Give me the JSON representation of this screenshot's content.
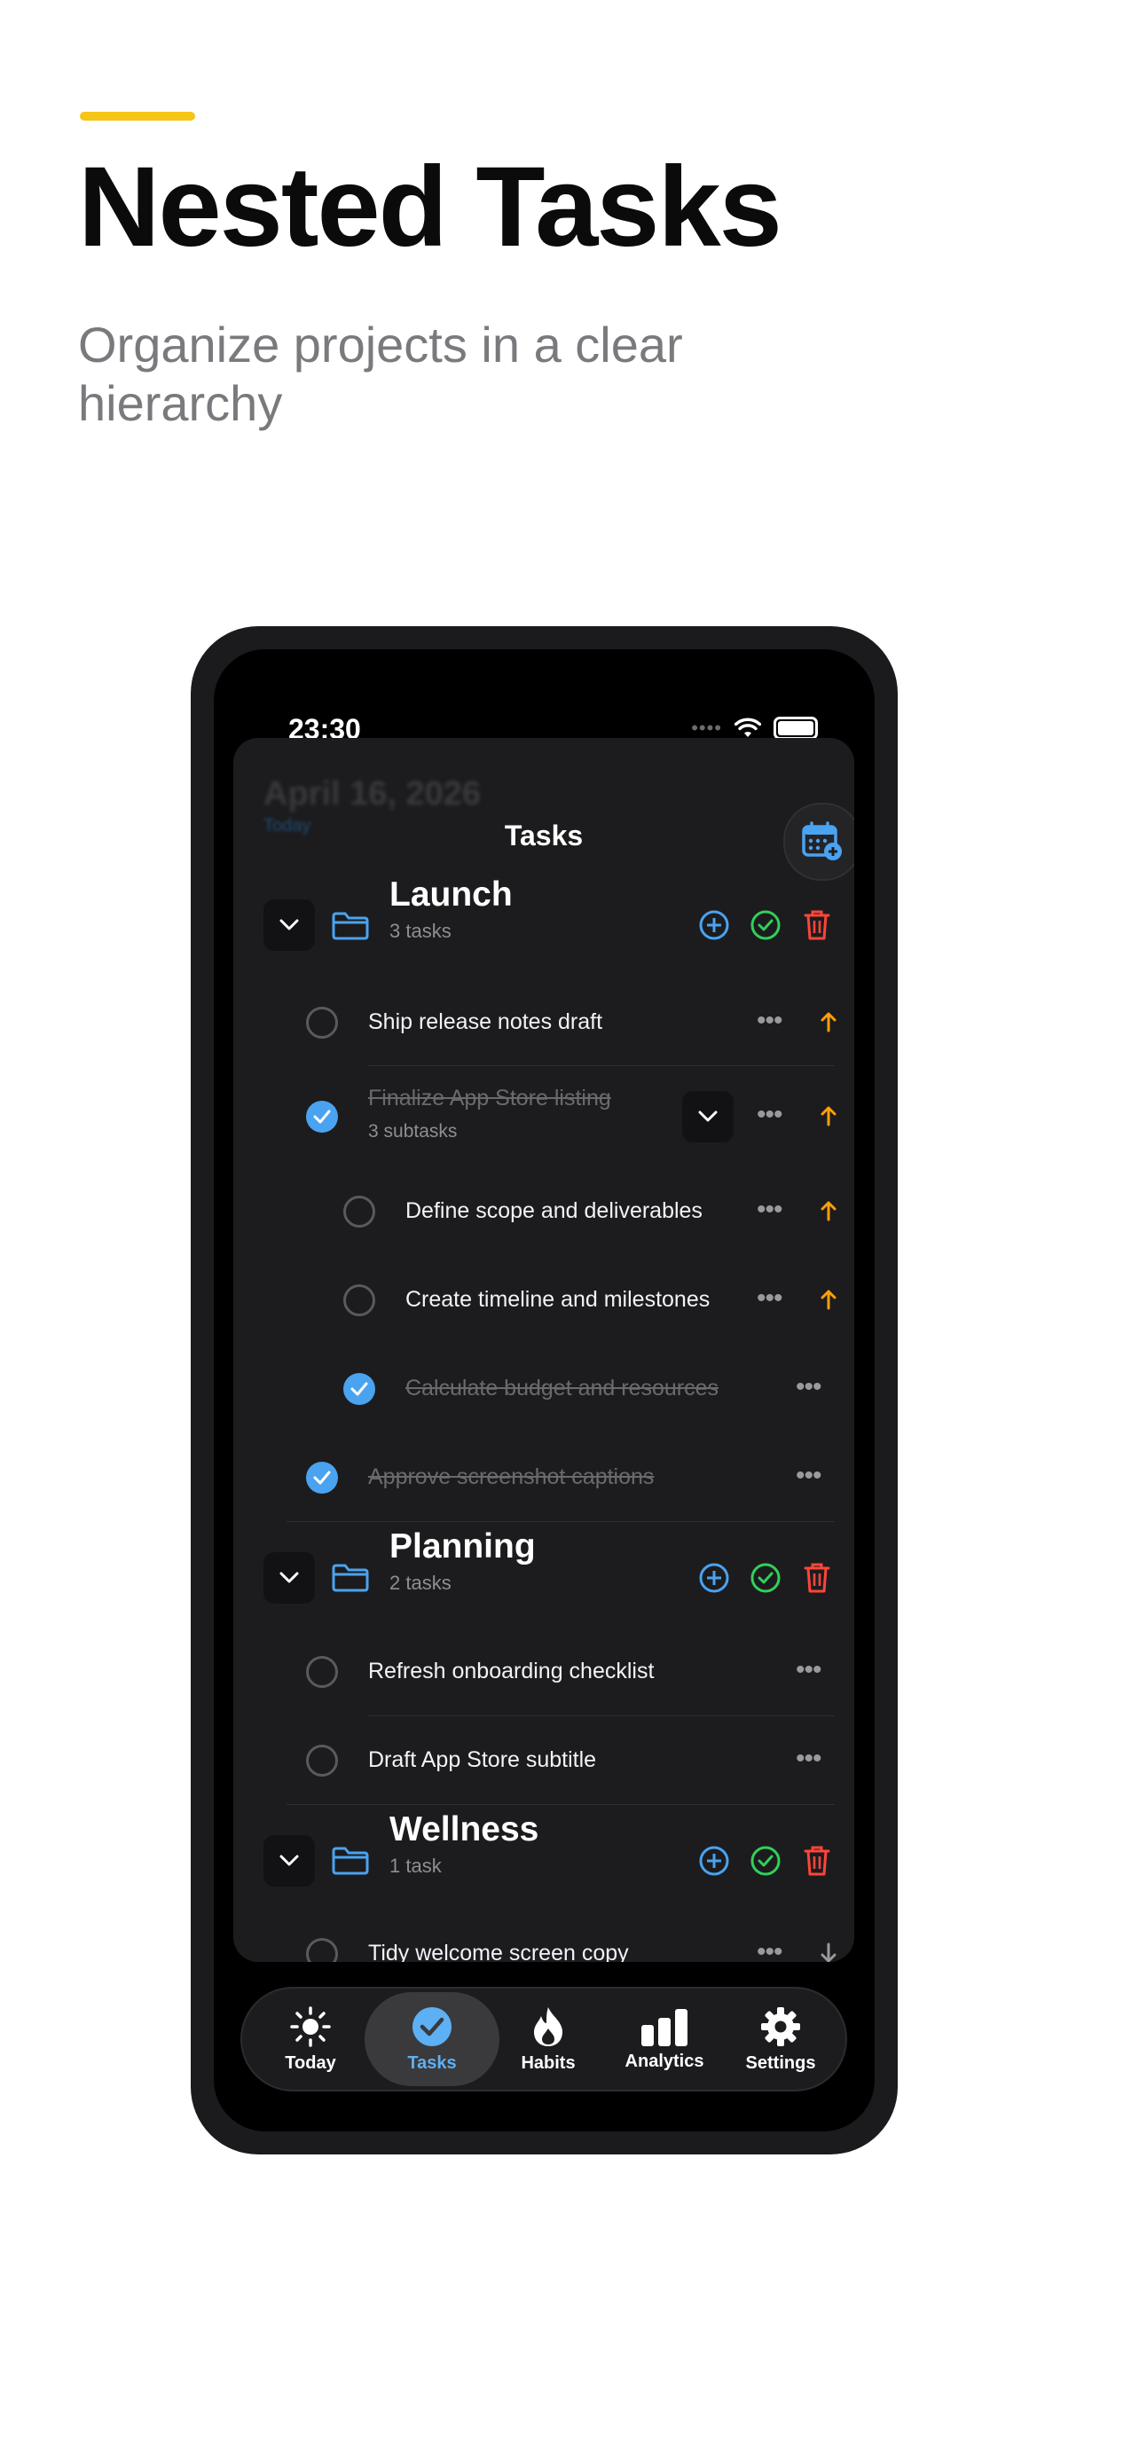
{
  "hero": {
    "title": "Nested Tasks",
    "subtitle": "Organize projects in a clear hierarchy"
  },
  "status": {
    "time": "23:30"
  },
  "background": {
    "date": "April 16, 2026",
    "today": "Today"
  },
  "nav": {
    "title": "Tasks"
  },
  "colors": {
    "accent_yellow": "#F5C518",
    "blue": "#4AA3F0",
    "green": "#30D158",
    "red": "#FF453A",
    "orange": "#FF9F0A"
  },
  "groups": [
    {
      "name": "Launch",
      "count": "3 tasks"
    },
    {
      "name": "Planning",
      "count": "2 tasks"
    },
    {
      "name": "Wellness",
      "count": "1 task"
    }
  ],
  "tasks": {
    "ship_release": {
      "label": "Ship release notes draft",
      "done": false,
      "priority": "high"
    },
    "finalize_listing": {
      "label": "Finalize App Store listing",
      "sub": "3 subtasks",
      "done": true,
      "priority": "high"
    },
    "define_scope": {
      "label": "Define scope and deliverables",
      "done": false,
      "priority": "high"
    },
    "create_timeline": {
      "label": "Create timeline and milestones",
      "done": false,
      "priority": "high"
    },
    "calc_budget": {
      "label": "Calculate budget and resources",
      "done": true
    },
    "approve_captions": {
      "label": "Approve screenshot captions",
      "done": true
    },
    "refresh_onboarding": {
      "label": "Refresh onboarding checklist",
      "done": false
    },
    "draft_subtitle": {
      "label": "Draft App Store subtitle",
      "done": false
    },
    "tidy_welcome": {
      "label": "Tidy welcome screen copy",
      "done": false,
      "priority": "low"
    }
  },
  "tabs": [
    {
      "label": "Today",
      "icon": "sun-icon"
    },
    {
      "label": "Tasks",
      "icon": "checkmark-circle-icon",
      "active": true
    },
    {
      "label": "Habits",
      "icon": "flame-icon"
    },
    {
      "label": "Analytics",
      "icon": "bar-chart-icon"
    },
    {
      "label": "Settings",
      "icon": "gear-icon"
    }
  ]
}
